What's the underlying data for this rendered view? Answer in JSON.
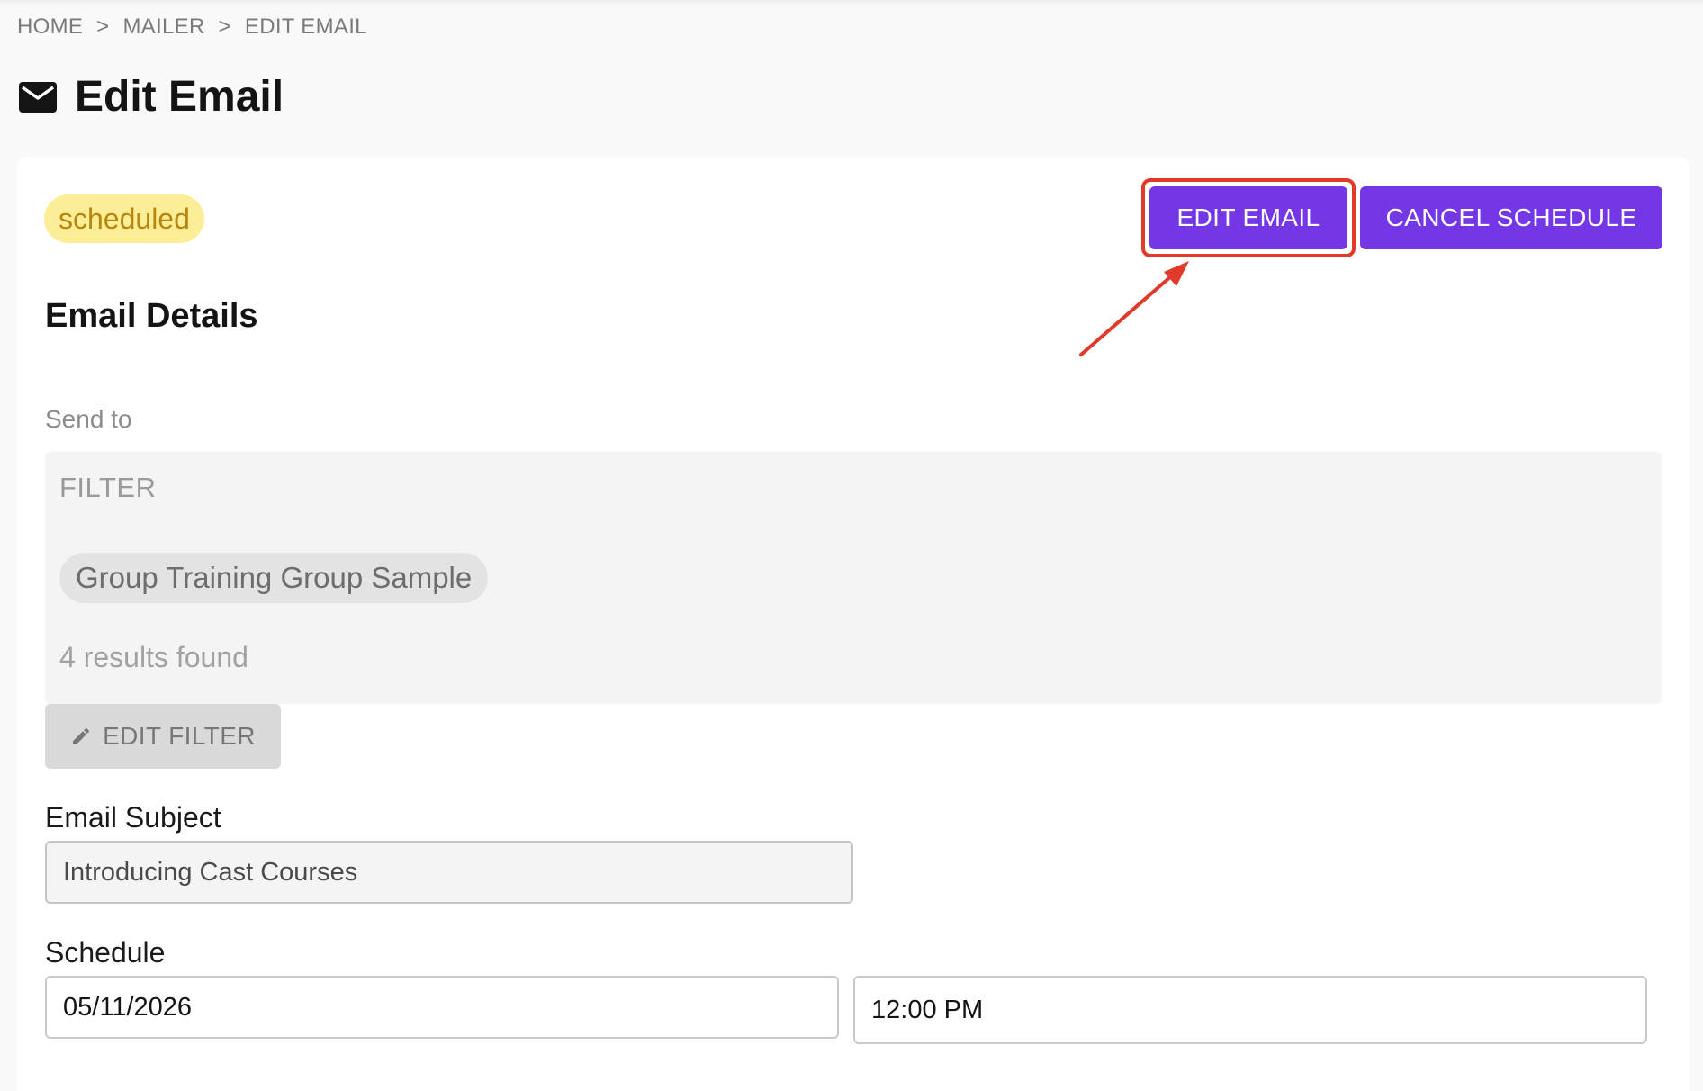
{
  "breadcrumb": {
    "home": "HOME",
    "separator": ">",
    "mailer": "MAILER",
    "current": "EDIT EMAIL"
  },
  "header": {
    "icon": "mail-icon",
    "title": "Edit Email"
  },
  "status": {
    "label": "scheduled",
    "bg_color": "#fcee97",
    "text_color": "#b6860e"
  },
  "actions": {
    "edit_label": "EDIT EMAIL",
    "cancel_label": "CANCEL SCHEDULE",
    "accent_color": "#7437e6",
    "annotation_color": "#e03b2a"
  },
  "details": {
    "section_title": "Email Details",
    "send_to_label": "Send to",
    "filter": {
      "heading": "FILTER",
      "chips": [
        "Group Training Group Sample"
      ],
      "results_text": "4 results found",
      "edit_button": "EDIT FILTER",
      "edit_icon": "pencil-icon"
    },
    "subject": {
      "label": "Email Subject",
      "value": "Introducing Cast Courses"
    },
    "schedule": {
      "label": "Schedule",
      "date": "05/11/2026",
      "time": "12:00 PM"
    }
  }
}
